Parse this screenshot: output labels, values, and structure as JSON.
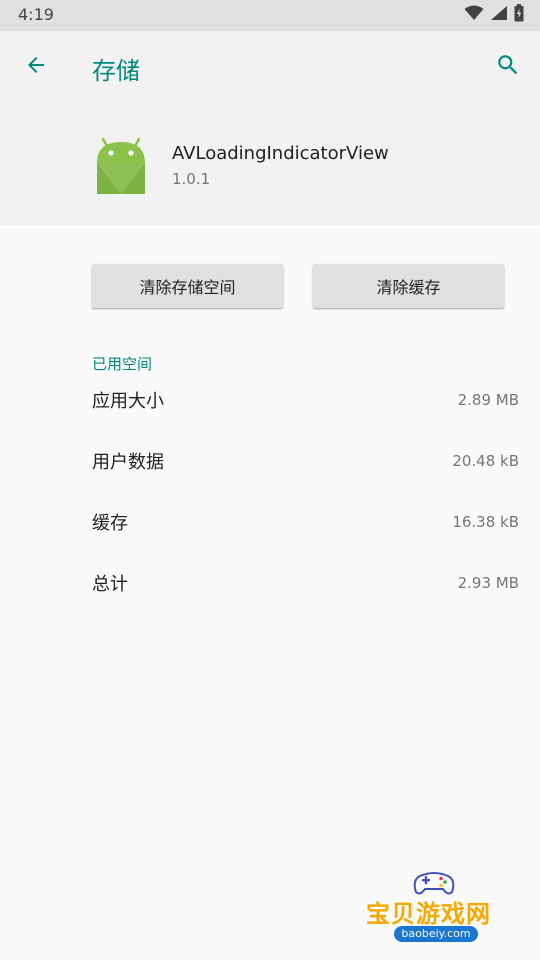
{
  "status_bar": {
    "time": "4:19",
    "icons": [
      "wifi-icon",
      "signal-icon",
      "battery-icon"
    ]
  },
  "app_bar": {
    "title": "存储",
    "back_icon": "arrow-back-icon",
    "search_icon": "search-icon"
  },
  "app_info": {
    "name": "AVLoadingIndicatorView",
    "version": "1.0.1",
    "icon": "android-icon"
  },
  "actions": {
    "clear_storage": "清除存储空间",
    "clear_cache": "清除缓存"
  },
  "storage": {
    "section_title": "已用空间",
    "rows": [
      {
        "label": "应用大小",
        "value": "2.89 MB"
      },
      {
        "label": "用户数据",
        "value": "20.48 kB"
      },
      {
        "label": "缓存",
        "value": "16.38 kB"
      },
      {
        "label": "总计",
        "value": "2.93 MB"
      }
    ]
  },
  "watermark": {
    "title": "宝贝游戏网",
    "url": "baobeiy.com"
  },
  "colors": {
    "accent": "#00897b",
    "status_bar": "#e0e0e0",
    "header_bg": "#f2f2f2",
    "android_green": "#8bc34a"
  }
}
